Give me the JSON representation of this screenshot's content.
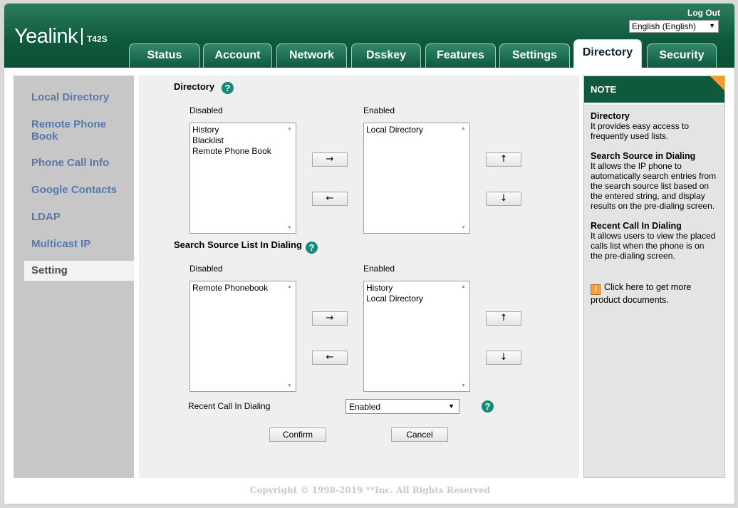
{
  "header": {
    "brand": "Yealink",
    "model": "T42S",
    "logout": "Log Out",
    "language": "English (English)"
  },
  "tabs": [
    {
      "label": "Status"
    },
    {
      "label": "Account"
    },
    {
      "label": "Network"
    },
    {
      "label": "Dsskey"
    },
    {
      "label": "Features"
    },
    {
      "label": "Settings"
    },
    {
      "label": "Directory",
      "active": true
    },
    {
      "label": "Security"
    }
  ],
  "sidebar": {
    "items": [
      {
        "label": "Local Directory"
      },
      {
        "label": "Remote Phone Book"
      },
      {
        "label": "Phone Call Info"
      },
      {
        "label": "Google Contacts"
      },
      {
        "label": "LDAP"
      },
      {
        "label": "Multicast IP"
      },
      {
        "label": "Setting",
        "active": true
      }
    ]
  },
  "directory": {
    "title": "Directory",
    "disabled_label": "Disabled",
    "enabled_label": "Enabled",
    "disabled_items": [
      "History",
      "Blacklist",
      "Remote Phone Book"
    ],
    "enabled_items": [
      "Local Directory"
    ]
  },
  "search_source": {
    "title": "Search Source List In Dialing",
    "disabled_label": "Disabled",
    "enabled_label": "Enabled",
    "disabled_items": [
      "Remote Phonebook"
    ],
    "enabled_items": [
      "History",
      "Local Directory"
    ]
  },
  "arrows": {
    "right": "→",
    "left": "←",
    "up": "↑",
    "down": "↓"
  },
  "recent_call": {
    "label": "Recent Call In Dialing",
    "value": "Enabled"
  },
  "buttons": {
    "confirm": "Confirm",
    "cancel": "Cancel"
  },
  "help_glyph": "?",
  "note": {
    "title": "NOTE",
    "blocks": [
      {
        "title": "Directory",
        "text": "It provides easy access to frequently used lists."
      },
      {
        "title": "Search Source in Dialing",
        "text": "It allows the IP phone to automatically search entries from the search source list based on the entered string, and display results on the pre-dialing screen."
      },
      {
        "title": "Recent Call In Dialing",
        "text": "It allows users to view the placed calls list when the phone is on the pre-dialing screen."
      }
    ],
    "link": "Click here to get more product documents."
  },
  "footer": "Copyright © 1998-2019 **Inc. All Rights Reserved",
  "colors": {
    "header_green": "#0f5a3d",
    "sidebar_link": "#5779a9",
    "help_teal": "#158a74",
    "note_corner": "#f59a2d"
  }
}
